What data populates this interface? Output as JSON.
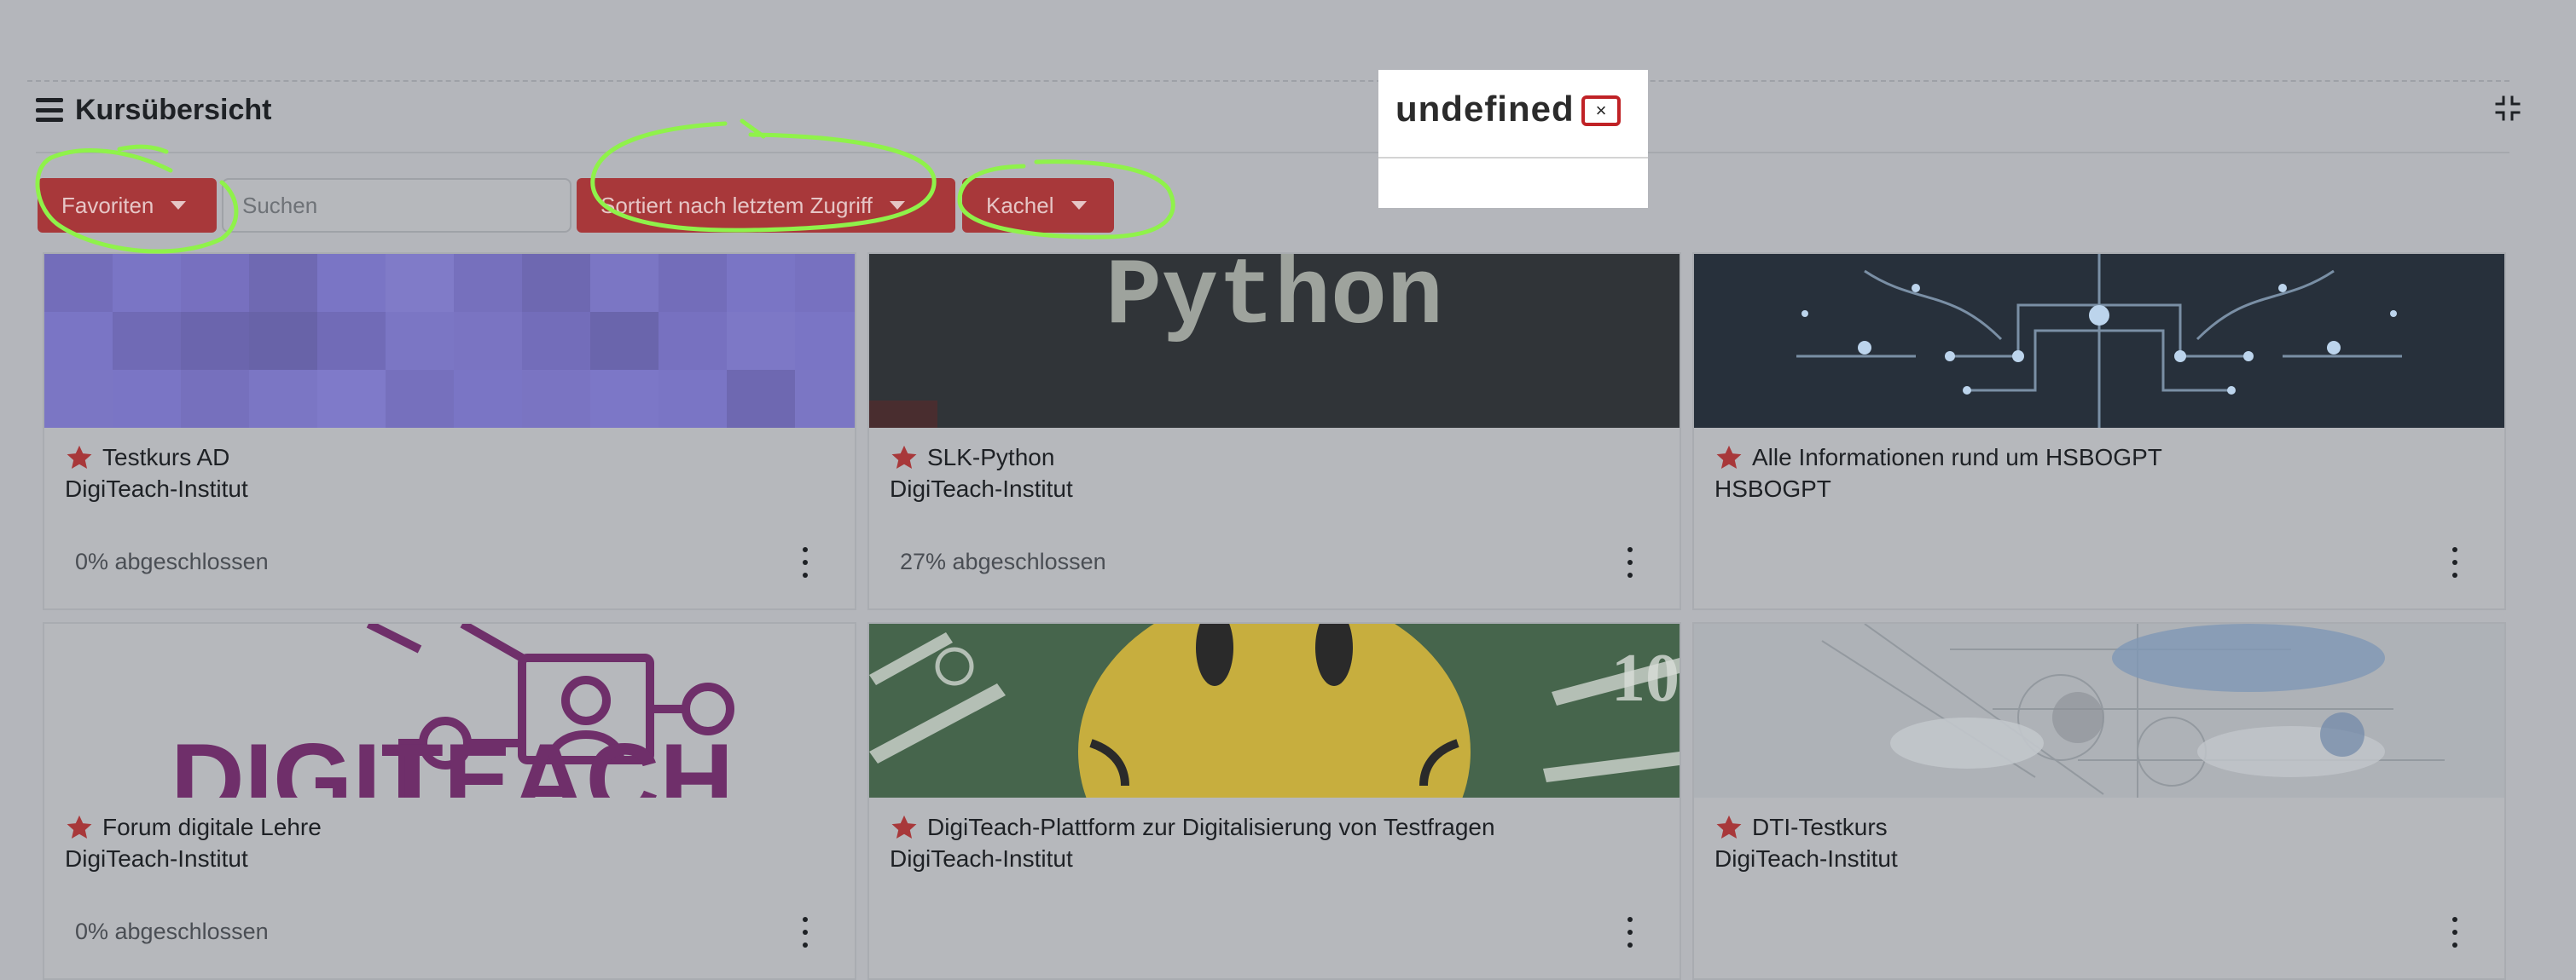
{
  "header": {
    "title": "Kursübersicht"
  },
  "toolbar": {
    "filter_label": "Favoriten",
    "search_placeholder": "Suchen",
    "sort_label": "Sortiert nach letztem Zugriff",
    "view_label": "Kachel"
  },
  "modal": {
    "title": "undefined",
    "close_label": "×"
  },
  "courses": [
    {
      "name": "Testkurs AD",
      "category": "DigiTeach-Institut",
      "progress": "0% abgeschlossen"
    },
    {
      "name": "SLK-Python",
      "category": "DigiTeach-Institut",
      "progress": "27% abgeschlossen",
      "image_text": "Python"
    },
    {
      "name": "Alle Informationen rund um HSBOGPT",
      "category": "HSBOGPT",
      "progress": ""
    },
    {
      "name": "Forum digitale Lehre",
      "category": "DigiTeach-Institut",
      "progress": "0% abgeschlossen",
      "image_text": "DIGITEACH"
    },
    {
      "name": "DigiTeach-Plattform zur Digitalisierung von Testfragen",
      "category": "DigiTeach-Institut",
      "progress": ""
    },
    {
      "name": "DTI-Testkurs",
      "category": "DigiTeach-Institut",
      "progress": ""
    }
  ],
  "colors": {
    "accent": "#a8383a",
    "annotation": "#8ff24a",
    "close_outline": "#c02226"
  },
  "icons": {
    "menu": "hamburger-icon",
    "collapse": "collapse-icon",
    "favorite": "star-icon",
    "actions": "vertical-dots-icon"
  }
}
